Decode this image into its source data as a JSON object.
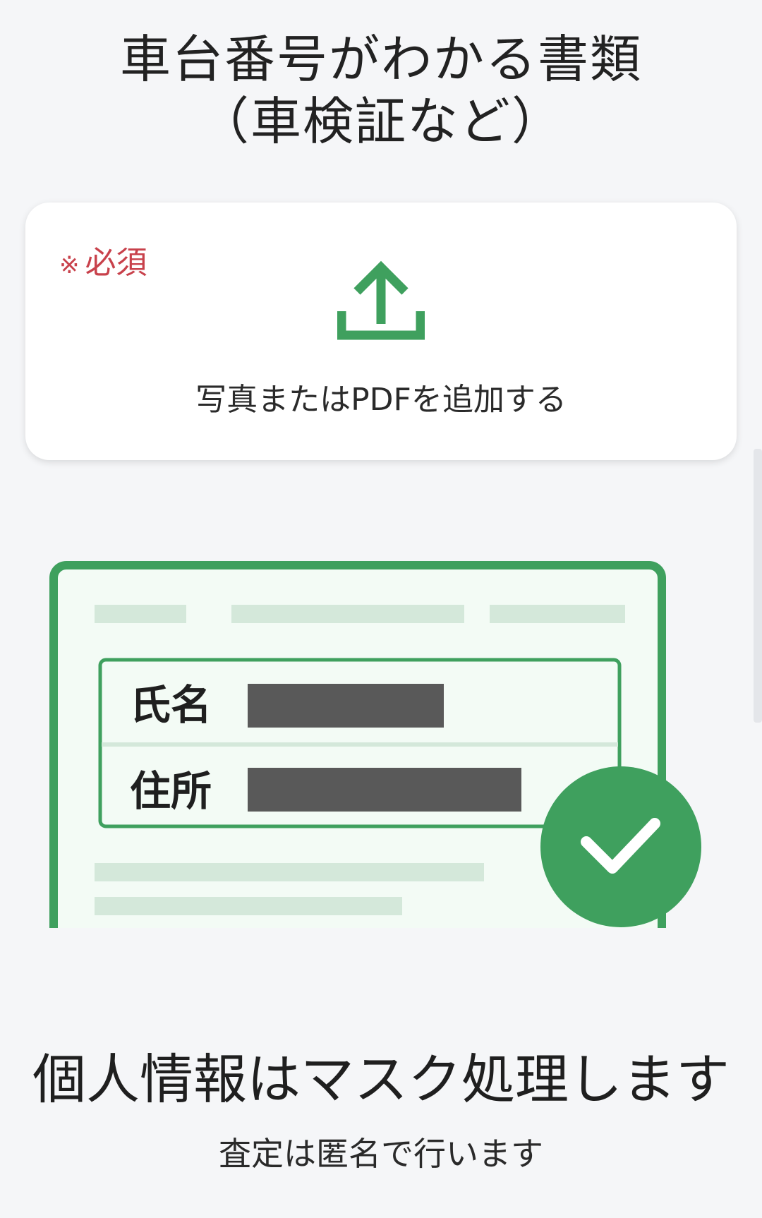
{
  "header": {
    "title_line1": "車台番号がわかる書類",
    "title_line2": "（車検証など）"
  },
  "upload": {
    "required_mark": "※",
    "required_label": "必須",
    "action_label": "写真またはPDFを追加する"
  },
  "illustration": {
    "name_label": "氏名",
    "address_label": "住所"
  },
  "caption": {
    "main": "個人情報はマスク処理します",
    "sub": "査定は匿名で行います"
  },
  "colors": {
    "accent_green": "#3fa05e",
    "required_red": "#c8414b",
    "mask_gray": "#595959",
    "light_green_fill": "#f3fbf5",
    "placeholder_green": "#d4e8da"
  }
}
